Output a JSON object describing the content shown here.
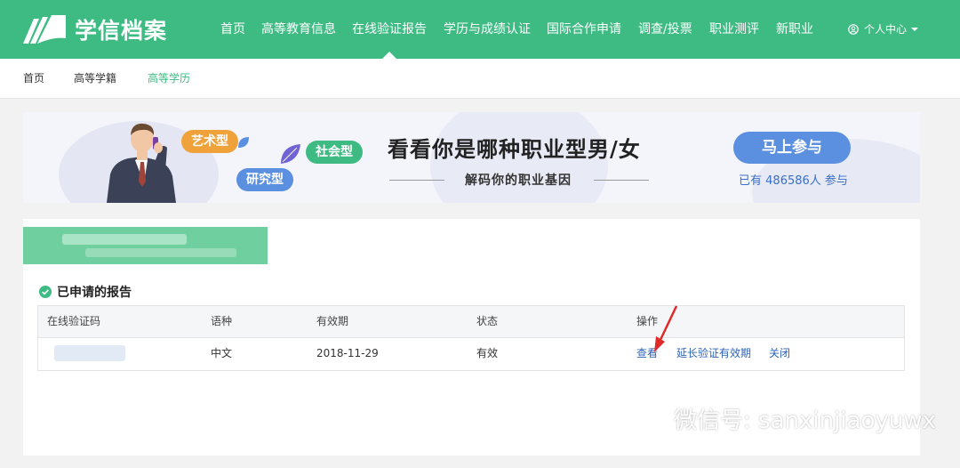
{
  "header": {
    "site_name": "学信档案",
    "nav": [
      "首页",
      "高等教育信息",
      "在线验证报告",
      "学历与成绩认证",
      "国际合作申请",
      "调查/投票",
      "职业测评",
      "新职业"
    ],
    "active_nav": "在线验证报告",
    "user_center": "个人中心"
  },
  "subnav": {
    "items": [
      "首页",
      "高等学籍",
      "高等学历"
    ],
    "active": "高等学历"
  },
  "banner": {
    "tags": [
      "艺术型",
      "社会型",
      "研究型"
    ],
    "title": "看看你是哪种职业型男/女",
    "subtitle": "解码你的职业基因",
    "button": "马上参与",
    "count_prefix": "已有",
    "count": "486586",
    "count_suffix": "人 参与"
  },
  "reports": {
    "section_title": "已申请的报告",
    "columns": [
      "在线验证码",
      "语种",
      "有效期",
      "状态",
      "操作"
    ],
    "rows": [
      {
        "language": "中文",
        "expiry": "2018-11-29",
        "status": "有效",
        "actions": [
          "查看",
          "延长验证有效期",
          "关闭"
        ]
      }
    ]
  },
  "watermark": "微信号: sanxinjiaoyuwx",
  "colors": {
    "brand_green": "#3dbb83",
    "link_blue": "#2f64b5",
    "button_blue": "#5b8fe0",
    "arrow_red": "#e02a2a"
  }
}
